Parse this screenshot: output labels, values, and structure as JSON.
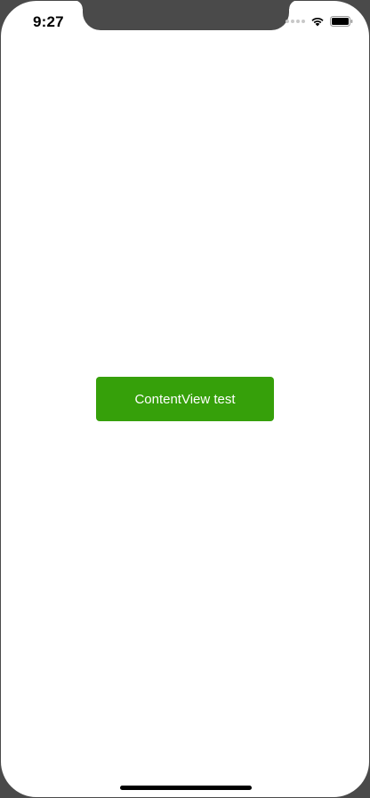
{
  "status_bar": {
    "time": "9:27",
    "icons": [
      "cellular-signal-icon",
      "wifi-icon",
      "battery-icon"
    ]
  },
  "main": {
    "button_label": "ContentView test",
    "button_color": "#36a00a"
  }
}
